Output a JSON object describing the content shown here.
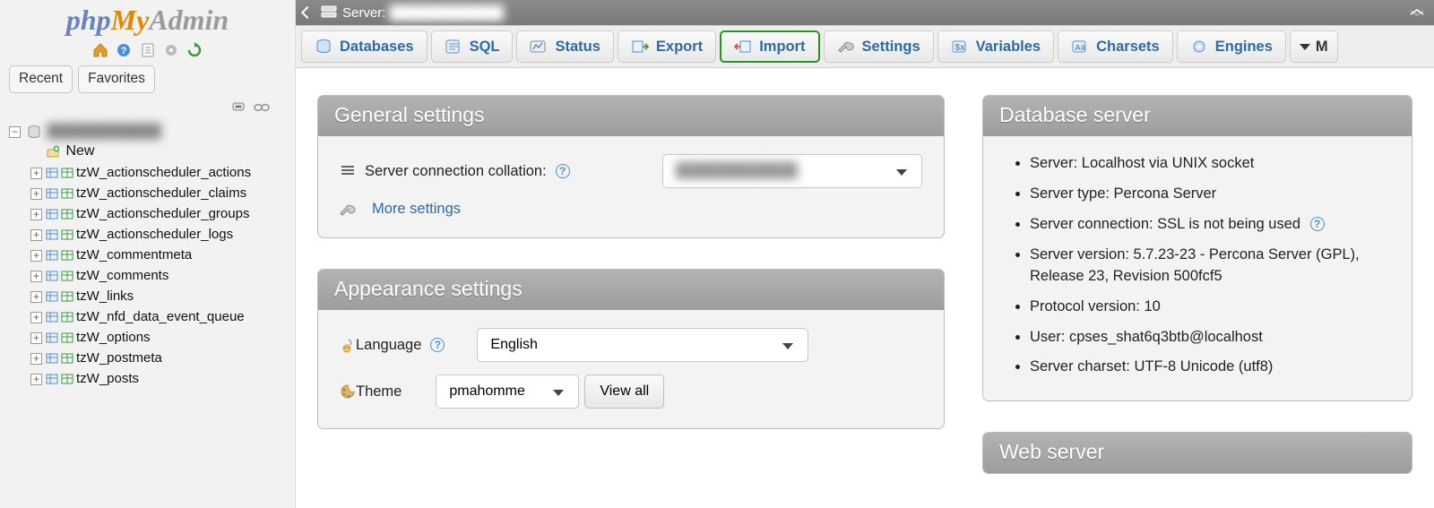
{
  "logo": {
    "part1": "php",
    "part2": "My",
    "part3": "Admin"
  },
  "sidebar_tabs": {
    "recent": "Recent",
    "favorites": "Favorites"
  },
  "tree": {
    "db_name": "████████████",
    "new_label": "New",
    "tables": [
      "tzW_actionscheduler_actions",
      "tzW_actionscheduler_claims",
      "tzW_actionscheduler_groups",
      "tzW_actionscheduler_logs",
      "tzW_commentmeta",
      "tzW_comments",
      "tzW_links",
      "tzW_nfd_data_event_queue",
      "tzW_options",
      "tzW_postmeta",
      "tzW_posts"
    ]
  },
  "topbar": {
    "server_label": "Server:",
    "server_value": "████████████"
  },
  "tabs": {
    "databases": "Databases",
    "sql": "SQL",
    "status": "Status",
    "export": "Export",
    "import": "Import",
    "settings": "Settings",
    "variables": "Variables",
    "charsets": "Charsets",
    "engines": "Engines",
    "more": "M"
  },
  "panels": {
    "general_title": "General settings",
    "collation_label": "Server connection collation:",
    "collation_value": "████████████",
    "more_settings": "More settings",
    "appearance_title": "Appearance settings",
    "language_label": "Language",
    "language_value": "English",
    "theme_label": "Theme",
    "theme_value": "pmahomme",
    "view_all": "View all",
    "dbserver_title": "Database server",
    "webserver_title": "Web server",
    "info": [
      "Server: Localhost via UNIX socket",
      "Server type: Percona Server",
      "Server connection: SSL is not being used",
      "Server version: 5.7.23-23 - Percona Server (GPL), Release 23, Revision 500fcf5",
      "Protocol version: 10",
      "User: cpses_shat6q3btb@localhost",
      "Server charset: UTF-8 Unicode (utf8)"
    ]
  }
}
